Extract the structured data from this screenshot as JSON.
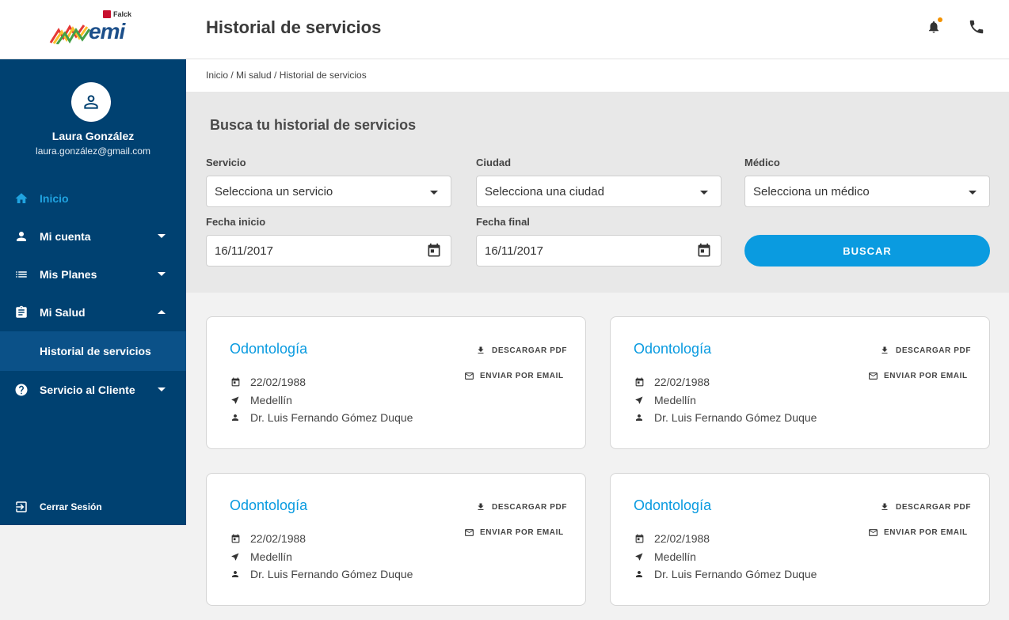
{
  "header": {
    "brand_tag": "Falck",
    "brand_name": "emi",
    "title": "Historial de servicios",
    "icons": [
      "bell-icon",
      "phone-icon"
    ],
    "notification_color": "#f39200"
  },
  "sidebar": {
    "user_name": "Laura González",
    "user_email": "laura.gonzález@gmail.com",
    "items": [
      {
        "label": "Inicio",
        "icon": "home-icon",
        "active": true
      },
      {
        "label": "Mi cuenta",
        "icon": "person-icon"
      },
      {
        "label": "Mis Planes",
        "icon": "list-icon"
      },
      {
        "label": "Mi Salud",
        "icon": "clipboard-icon",
        "expanded": true
      },
      {
        "label": "Servicio al Cliente",
        "icon": "help-icon"
      }
    ],
    "subitem": "Historial de servicios",
    "logout": "Cerrar Sesión",
    "bg_color": "#004171",
    "active_color": "#20a3e0"
  },
  "breadcrumb": "Inicio / Mi salud / Historial de servicios",
  "search": {
    "title": "Busca tu historial de servicios",
    "servicio_label": "Servicio",
    "servicio_value": "Selecciona un servicio",
    "ciudad_label": "Ciudad",
    "ciudad_value": "Selecciona una ciudad",
    "medico_label": "Médico",
    "medico_value": "Selecciona un médico",
    "fecha_inicio_label": "Fecha inicio",
    "fecha_inicio_value": "16/11/2017",
    "fecha_final_label": "Fecha final",
    "fecha_final_value": "16/11/2017",
    "button": "BUSCAR",
    "accent_color": "#0a9be0"
  },
  "cards": [
    {
      "title": "Odontología",
      "date": "22/02/1988",
      "city": "Medellín",
      "doctor": "Dr. Luis Fernando Gómez Duque",
      "pdf": "DESCARGAR PDF",
      "email": "ENVIAR POR EMAIL"
    },
    {
      "title": "Odontología",
      "date": "22/02/1988",
      "city": "Medellín",
      "doctor": "Dr. Luis Fernando Gómez Duque",
      "pdf": "DESCARGAR PDF",
      "email": "ENVIAR POR EMAIL"
    },
    {
      "title": "Odontología",
      "date": "22/02/1988",
      "city": "Medellín",
      "doctor": "Dr. Luis Fernando Gómez Duque",
      "pdf": "DESCARGAR PDF",
      "email": "ENVIAR POR EMAIL"
    },
    {
      "title": "Odontología",
      "date": "22/02/1988",
      "city": "Medellín",
      "doctor": "Dr. Luis Fernando Gómez Duque",
      "pdf": "DESCARGAR PDF",
      "email": "ENVIAR POR EMAIL"
    }
  ]
}
